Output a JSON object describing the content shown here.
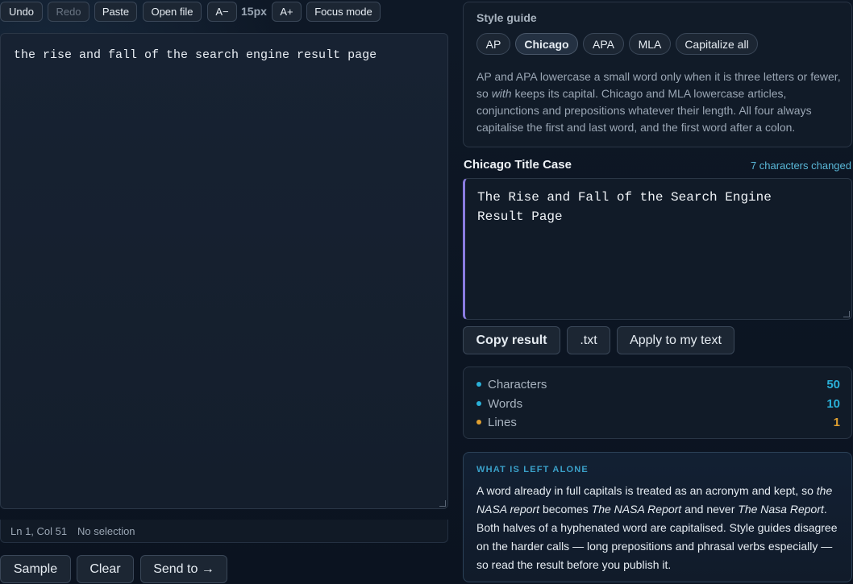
{
  "toolbar": {
    "undo": "Undo",
    "redo": "Redo",
    "paste": "Paste",
    "open_file": "Open file",
    "font_decrease": "A−",
    "font_size": "15px",
    "font_increase": "A+",
    "focus_mode": "Focus mode"
  },
  "editor": {
    "text": "the rise and fall of the search engine result page"
  },
  "status": {
    "position": "Ln 1, Col 51",
    "selection": "No selection"
  },
  "bottom_actions": {
    "sample": "Sample",
    "clear": "Clear",
    "send_to": "Send to →"
  },
  "style_guide": {
    "title": "Style guide",
    "options": [
      "AP",
      "Chicago",
      "APA",
      "MLA",
      "Capitalize all"
    ],
    "selected": "Chicago",
    "description": {
      "p1": "AP and APA lowercase a small word only when it is three letters or fewer, so ",
      "em": "with",
      "p2": " keeps its capital. Chicago and MLA lowercase articles, conjunctions and prepositions whatever their length. All four always capitalise the first and last word, and the first word after a colon."
    }
  },
  "result": {
    "title": "Chicago Title Case",
    "changed": "7 characters changed",
    "text": "The Rise and Fall of the Search Engine Result Page",
    "copy": "Copy result",
    "txt": ".txt",
    "apply": "Apply to my text"
  },
  "stats": {
    "items": [
      {
        "label": "Characters",
        "value": "50",
        "color": "#2ab0d8"
      },
      {
        "label": "Words",
        "value": "10",
        "color": "#2ab0d8"
      },
      {
        "label": "Lines",
        "value": "1",
        "color": "#e0a030"
      }
    ]
  },
  "note": {
    "heading": "WHAT IS LEFT ALONE",
    "t1": "A word already in full capitals is treated as an acronym and kept, so ",
    "e1": "the NASA report",
    "t2": " becomes ",
    "e2": "The NASA Report",
    "t3": " and never ",
    "e3": "The Nasa Report",
    "t4": ". Both halves of a hyphenated word are capitalised. Style guides disagree on the harder calls — long prepositions and phrasal verbs especially — so read the result before you publish it."
  },
  "colors": {
    "accent_cyan": "#5ab8d8",
    "accent_purple": "#8a7ce0",
    "accent_orange": "#e0a030"
  }
}
